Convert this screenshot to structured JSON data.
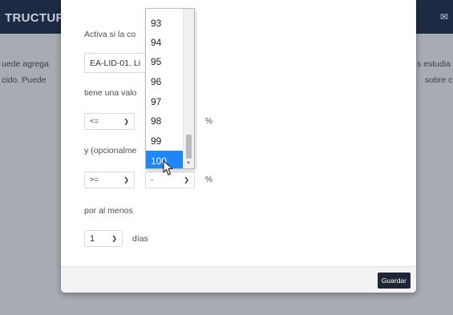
{
  "background": {
    "app_title": "TRUCTUF",
    "left_text_1": "uede agrega",
    "left_text_2": "cido. Puede",
    "right_text_1": "s estudia",
    "right_text_2": "sobre c"
  },
  "modal": {
    "activate_label": "Activa si la co",
    "item_field_value": "EA-LID-01. Li",
    "value_label": "tiene una valo",
    "first_operator": "<=",
    "percent_1": "%",
    "optional_label": "y (opcionalme",
    "second_operator": ">=",
    "second_value": "-",
    "percent_2": "%",
    "at_least_label": "por al menos",
    "days_value": "1",
    "days_label": "días",
    "save_label": "Guardar"
  },
  "dropdown": {
    "options": [
      "93",
      "94",
      "95",
      "96",
      "97",
      "98",
      "99",
      "100"
    ],
    "selected": "100"
  }
}
